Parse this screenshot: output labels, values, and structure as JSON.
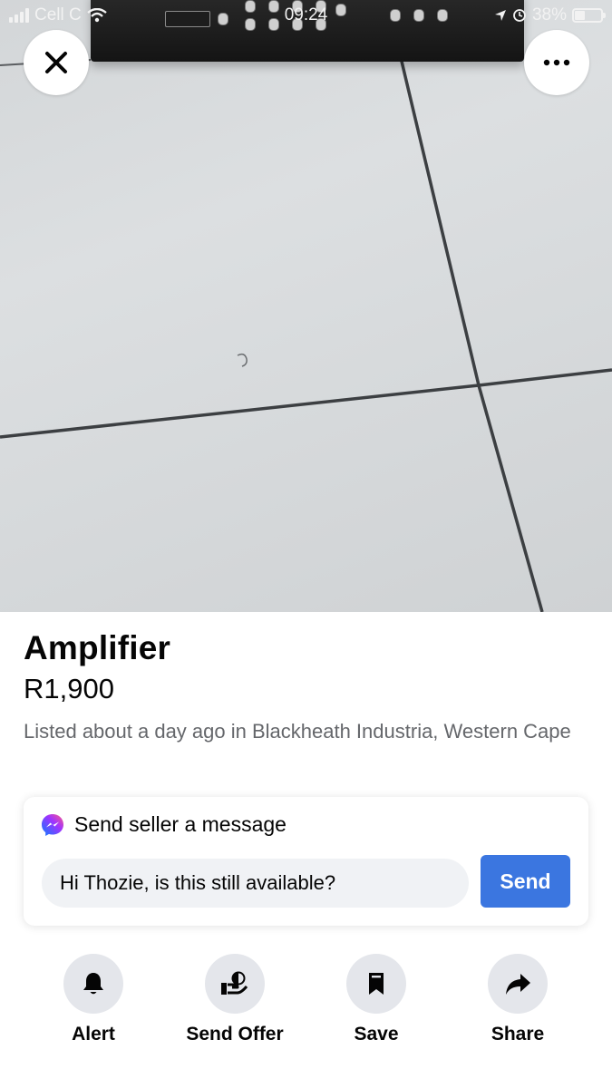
{
  "status_bar": {
    "carrier": "Cell C",
    "time": "09:24",
    "battery": "38%",
    "battery_level": 0.38
  },
  "photo": {
    "close_icon": "close-icon",
    "more_icon": "more-horizontal-icon"
  },
  "listing": {
    "title": "Amplifier",
    "price": "R1,900",
    "listed": "Listed about a day ago in Blackheath Industria, Western Cape"
  },
  "message": {
    "heading": "Send seller a message",
    "input_value": "Hi Thozie, is this still available?",
    "send_label": "Send",
    "messenger_icon": "messenger-icon"
  },
  "actions": [
    {
      "label": "Alert",
      "icon": "bell-icon"
    },
    {
      "label": "Send Offer",
      "icon": "offer-icon"
    },
    {
      "label": "Save",
      "icon": "bookmark-icon"
    },
    {
      "label": "Share",
      "icon": "share-icon"
    }
  ],
  "colors": {
    "accent": "#3b76e0",
    "secondary_text": "#65676b",
    "icon_bg": "#e4e6eb",
    "input_bg": "#f0f2f5"
  }
}
